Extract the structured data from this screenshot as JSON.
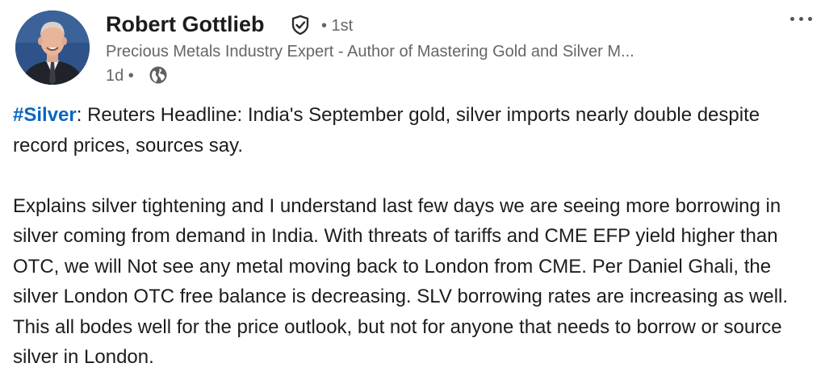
{
  "author": {
    "name": "Robert Gottlieb",
    "connection_degree": "• 1st",
    "headline": "Precious Metals Industry Expert - Author of Mastering Gold and Silver M...",
    "time_ago": "1d •"
  },
  "post": {
    "hashtag": "#Silver",
    "first_paragraph_rest": ": Reuters Headline: India's September gold, silver imports nearly double despite record prices, sources say.",
    "second_paragraph": "Explains silver tightening and I understand last few days we are seeing more borrowing in silver coming from demand in India. With threats of tariffs and CME EFP yield higher than OTC, we will Not see any metal moving back to London from CME. Per Daniel Ghali, the silver London OTC free balance is decreasing. SLV borrowing rates are increasing as well. This all bodes well for the price outlook, but not for anyone that needs to borrow or source silver in London."
  },
  "icons": {
    "verified": "verified-shield-check-icon",
    "visibility": "globe-icon",
    "menu": "more-options-icon"
  },
  "colors": {
    "hashtag": "#0a66c2",
    "secondary_text": "#666666",
    "primary_text": "#1d1d1d"
  }
}
